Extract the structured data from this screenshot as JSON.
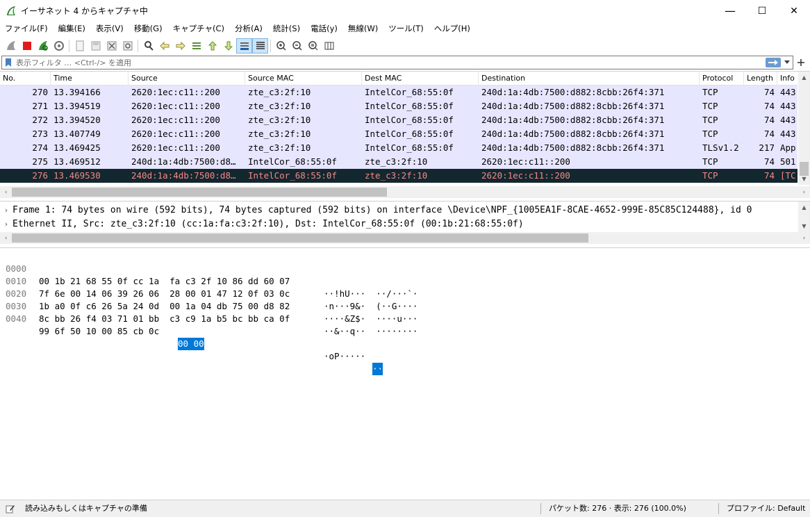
{
  "window": {
    "title": "イーサネット 4 からキャプチャ中",
    "minimize": "—",
    "maximize": "☐",
    "close": "✕"
  },
  "menu": [
    "ファイル(F)",
    "編集(E)",
    "表示(V)",
    "移動(G)",
    "キャプチャ(C)",
    "分析(A)",
    "統計(S)",
    "電話(y)",
    "無線(W)",
    "ツール(T)",
    "ヘルプ(H)"
  ],
  "filter": {
    "placeholder": "表示フィルタ … <Ctrl-/> を適用",
    "value": ""
  },
  "columns": [
    "No.",
    "Time",
    "Source",
    "Source MAC",
    "Dest MAC",
    "Destination",
    "Protocol",
    "Length",
    "Info"
  ],
  "packets": [
    {
      "no": "270",
      "time": "13.394166",
      "src": "2620:1ec:c11::200",
      "smac": "zte_c3:2f:10",
      "dmac": "IntelCor_68:55:0f",
      "dst": "240d:1a:4db:7500:d882:8cbb:26f4:371",
      "proto": "TCP",
      "len": "74",
      "info": "443"
    },
    {
      "no": "271",
      "time": "13.394519",
      "src": "2620:1ec:c11::200",
      "smac": "zte_c3:2f:10",
      "dmac": "IntelCor_68:55:0f",
      "dst": "240d:1a:4db:7500:d882:8cbb:26f4:371",
      "proto": "TCP",
      "len": "74",
      "info": "443"
    },
    {
      "no": "272",
      "time": "13.394520",
      "src": "2620:1ec:c11::200",
      "smac": "zte_c3:2f:10",
      "dmac": "IntelCor_68:55:0f",
      "dst": "240d:1a:4db:7500:d882:8cbb:26f4:371",
      "proto": "TCP",
      "len": "74",
      "info": "443"
    },
    {
      "no": "273",
      "time": "13.407749",
      "src": "2620:1ec:c11::200",
      "smac": "zte_c3:2f:10",
      "dmac": "IntelCor_68:55:0f",
      "dst": "240d:1a:4db:7500:d882:8cbb:26f4:371",
      "proto": "TCP",
      "len": "74",
      "info": "443"
    },
    {
      "no": "274",
      "time": "13.469425",
      "src": "2620:1ec:c11::200",
      "smac": "zte_c3:2f:10",
      "dmac": "IntelCor_68:55:0f",
      "dst": "240d:1a:4db:7500:d882:8cbb:26f4:371",
      "proto": "TLSv1.2",
      "len": "217",
      "info": "App"
    },
    {
      "no": "275",
      "time": "13.469512",
      "src": "240d:1a:4db:7500:d8…",
      "smac": "IntelCor_68:55:0f",
      "dmac": "zte_c3:2f:10",
      "dst": "2620:1ec:c11::200",
      "proto": "TCP",
      "len": "74",
      "info": "501"
    },
    {
      "no": "276",
      "time": "13.469530",
      "src": "240d:1a:4db:7500:d8…",
      "smac": "IntelCor_68:55:0f",
      "dmac": "zte_c3:2f:10",
      "dst": "2620:1ec:c11::200",
      "proto": "TCP",
      "len": "74",
      "info": "[TC"
    }
  ],
  "details": [
    "Frame 1: 74 bytes on wire (592 bits), 74 bytes captured (592 bits) on interface \\Device\\NPF_{1005EA1F-8CAE-4652-999E-85C85C124488}, id 0",
    "Ethernet II, Src: zte_c3:2f:10 (cc:1a:fa:c3:2f:10), Dst: IntelCor_68:55:0f (00:1b:21:68:55:0f)"
  ],
  "detail_caret": "›",
  "bytes": [
    {
      "off": "0000",
      "hex": "00 1b 21 68 55 0f cc 1a  fa c3 2f 10 86 dd 60 07",
      "sel": "",
      "ascii": "··!hU···  ··/···`·",
      "asel": ""
    },
    {
      "off": "0010",
      "hex": "7f 6e 00 14 06 39 26 06  28 00 01 47 12 0f 03 0c",
      "sel": "",
      "ascii": "·n···9&·  (··G····",
      "asel": ""
    },
    {
      "off": "0020",
      "hex": "1b a0 0f c6 26 5a 24 0d  00 1a 04 db 75 00 d8 82",
      "sel": "",
      "ascii": "····&Z$·  ····u···",
      "asel": ""
    },
    {
      "off": "0030",
      "hex": "8c bb 26 f4 03 71 01 bb  c3 c9 1a b5 bc bb ca 0f",
      "sel": "",
      "ascii": "··&··q··  ········",
      "asel": ""
    },
    {
      "off": "0040",
      "hex": "99 6f 50 10 00 85 cb 0c",
      "sel": "00 00",
      "ascii": "·oP·····",
      "asel": "··"
    }
  ],
  "status": {
    "ready": "読み込みもしくはキャプチャの準備",
    "packets": "パケット数: 276 · 表示: 276 (100.0%)",
    "profile": "プロファイル: Default"
  },
  "colors": {
    "row_bg": "#e7e6ff",
    "selected_bg": "#12272e",
    "selected_fg": "#f78787",
    "byte_highlight": "#0078d7"
  }
}
